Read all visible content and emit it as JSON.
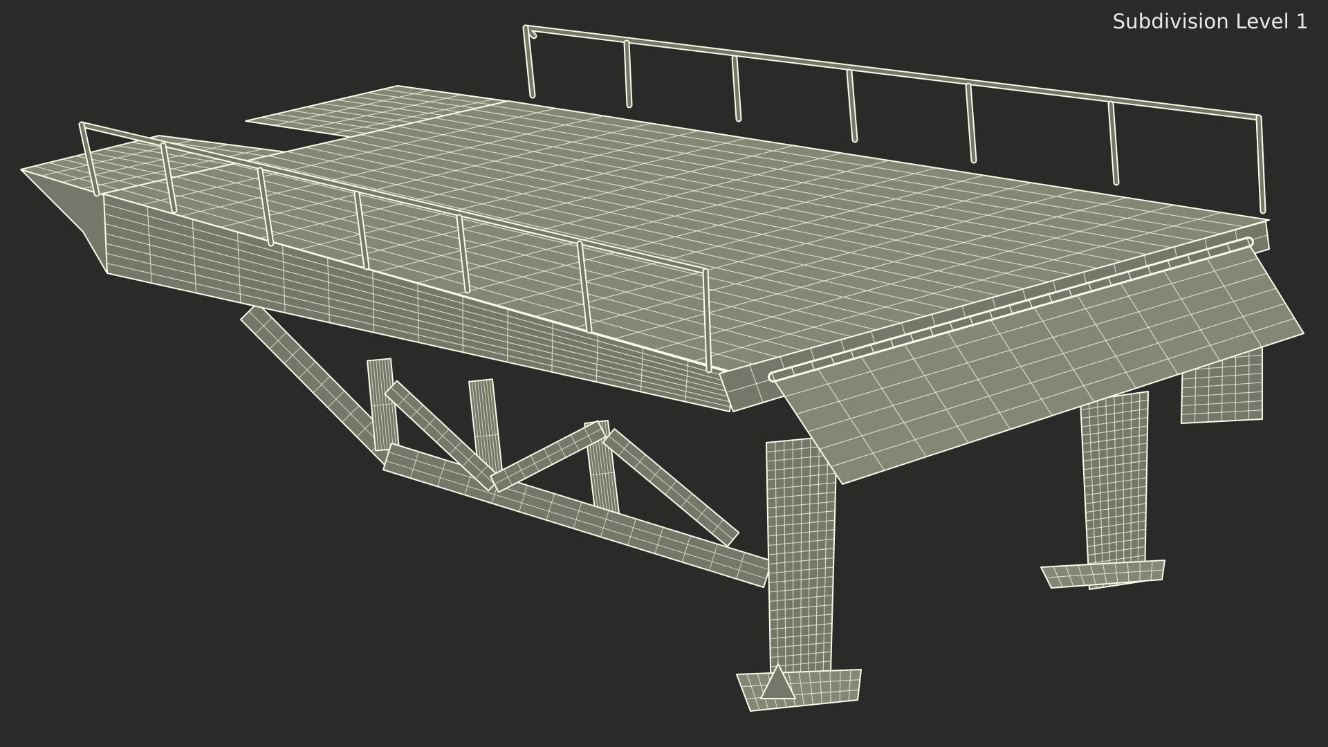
{
  "viewport": {
    "label": "Subdivision Level 1",
    "background": "#2a2a29"
  },
  "model": {
    "subject": "wireframe-3d-model",
    "surface_color": "#76776a",
    "surface_light_color": "#858676",
    "wire_color": "#f0f0dc",
    "edge_color": "#fbfbea"
  }
}
